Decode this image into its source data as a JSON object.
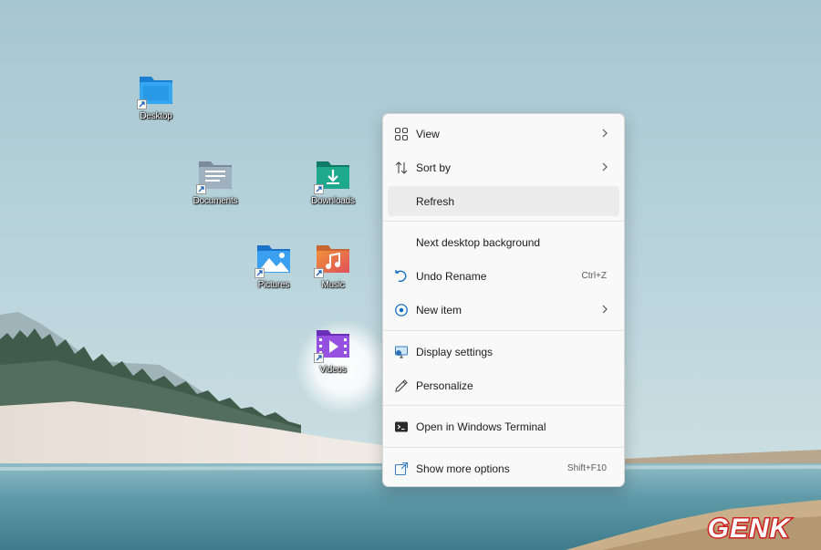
{
  "desktop": {
    "icons": [
      {
        "label": "Desktop",
        "icon": "desktop-folder-icon"
      },
      {
        "label": "Documents",
        "icon": "documents-folder-icon"
      },
      {
        "label": "Downloads",
        "icon": "downloads-folder-icon"
      },
      {
        "label": "Pictures",
        "icon": "pictures-folder-icon"
      },
      {
        "label": "Music",
        "icon": "music-folder-icon"
      },
      {
        "label": "Videos",
        "icon": "videos-folder-icon"
      }
    ]
  },
  "context_menu": {
    "items": [
      {
        "label": "View",
        "icon": "view-grid-icon",
        "submenu": true
      },
      {
        "label": "Sort by",
        "icon": "sort-arrows-icon",
        "submenu": true
      },
      {
        "label": "Refresh",
        "icon": "",
        "highlighted": true
      },
      {
        "label": "Next desktop background",
        "icon": ""
      },
      {
        "label": "Undo Rename",
        "icon": "undo-icon",
        "shortcut": "Ctrl+Z"
      },
      {
        "label": "New item",
        "icon": "new-item-icon",
        "submenu": true
      },
      {
        "label": "Display settings",
        "icon": "display-settings-icon"
      },
      {
        "label": "Personalize",
        "icon": "personalize-pen-icon"
      },
      {
        "label": "Open in Windows Terminal",
        "icon": "terminal-icon"
      },
      {
        "label": "Show more options",
        "icon": "show-more-options-icon",
        "shortcut": "Shift+F10"
      }
    ]
  },
  "watermark": {
    "text": "GENK"
  },
  "colors": {
    "accent": "#0067c0",
    "menu_bg": "#f9f9f9",
    "sky": "#a9cbd6",
    "water": "#5e9aa8"
  }
}
